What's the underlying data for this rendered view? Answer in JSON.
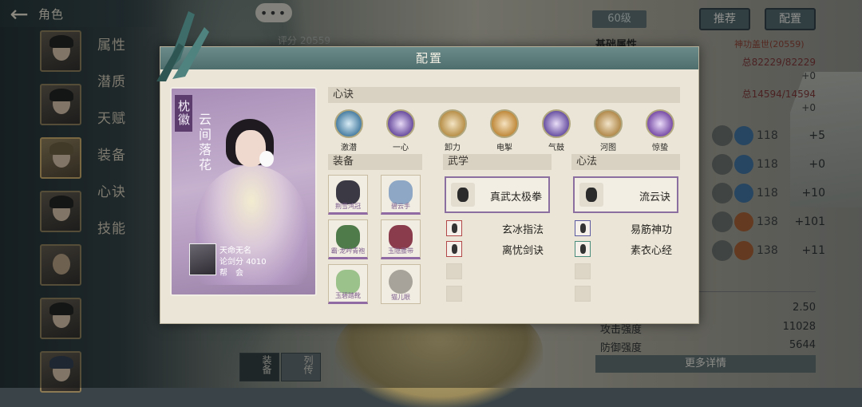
{
  "header": {
    "back_icon": "arrow-left-icon",
    "title": "角色"
  },
  "menu": [
    "属性",
    "潜质",
    "天赋",
    "装备",
    "心诀",
    "技能"
  ],
  "top": {
    "chat_dots": "•••",
    "score": "评分 20559"
  },
  "right_panel": {
    "level": "60级",
    "btn_recommend": "推荐",
    "btn_config": "配置",
    "basic_attrs": "基础属性",
    "title_badge": "神功盖世(20559)",
    "hp": "总82229/82229",
    "hp_delta": "+0",
    "mp": "总14594/14594",
    "mp_delta": "+0",
    "stats": [
      {
        "value": "118",
        "plus": "+5",
        "color": "#3c6f9c"
      },
      {
        "value": "118",
        "plus": "+0",
        "color": "#3c6f9c"
      },
      {
        "value": "118",
        "plus": "+10",
        "color": "#3c6f9c"
      },
      {
        "value": "138",
        "plus": "+101",
        "color": "#a55a2b"
      },
      {
        "value": "138",
        "plus": "+11",
        "color": "#a55a2b"
      }
    ],
    "detail_value_1": "2.50",
    "attack_label": "攻击强度",
    "attack_value": "11028",
    "defense_label": "防御强度",
    "defense_value": "5644",
    "more": "更多详情"
  },
  "bottom_tabs": [
    {
      "label": "装备"
    },
    {
      "label": "列传"
    }
  ],
  "modal": {
    "title": "配置",
    "card": {
      "name": "枕徽",
      "title": "云间落花",
      "owner": "天命无名",
      "sword_score": "论剑分 4010",
      "guild": "帮　会"
    },
    "sections": {
      "xinjue": "心诀",
      "equip": "装备",
      "wuxue": "武学",
      "xinfa": "心法"
    },
    "xinjue": [
      {
        "name": "激潜",
        "color": "#4a7fa3"
      },
      {
        "name": "一心",
        "color": "#6b4fa0"
      },
      {
        "name": "卸力",
        "color": "#b8904a"
      },
      {
        "name": "电掣",
        "color": "#c08a3c"
      },
      {
        "name": "气鼓",
        "color": "#6a52a3"
      },
      {
        "name": "河图",
        "color": "#b28a4c"
      },
      {
        "name": "惊蛰",
        "color": "#7a4fa8"
      }
    ],
    "equipment": [
      {
        "name": "荆雪鸿冠",
        "color": "#3b3a44"
      },
      {
        "name": "碧云手",
        "color": "#8ea7c4"
      },
      {
        "name": "霸·龙吟青袍",
        "color": "#4f7a4a"
      },
      {
        "name": "玉隐腰带",
        "color": "#8a3c4d"
      },
      {
        "name": "玉碧踏靴",
        "color": "#9bc28a"
      },
      {
        "name": "猫儿眼",
        "color": "#a7a39a"
      }
    ],
    "wuxue": {
      "main": "真武太极拳",
      "skills": [
        "玄冰指法",
        "离忧剑诀"
      ]
    },
    "xinfa": {
      "main": "流云诀",
      "skills": [
        "易筋神功",
        "素衣心经"
      ]
    }
  }
}
